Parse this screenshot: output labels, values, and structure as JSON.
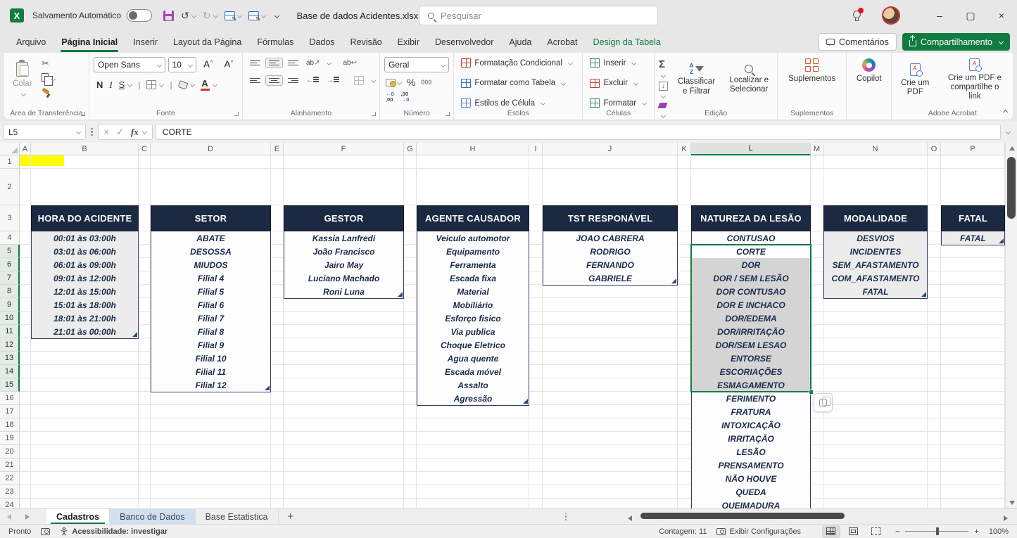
{
  "colors": {
    "accent_green": "#107C41",
    "table_header_navy": "#1b2942",
    "selection_fill": "#d4d4d4",
    "highlight_yellow": "#ffff00"
  },
  "icons": {
    "search": "magnifier",
    "save": "floppy-disk",
    "undo": "arrow-ccw",
    "redo": "arrow-cw",
    "comments": "speech-bubble",
    "share": "box-arrow-up",
    "copilot": "color-swirl",
    "addins": "orange-grid",
    "pdf": "page-with-link"
  },
  "titlebar": {
    "autosave_label": "Salvamento Automático",
    "filename": "Base de dados Acidentes.xlsx",
    "search_placeholder": "Pesquisar",
    "undo_glyph": "↺",
    "redo_glyph": "↻",
    "minimize": "–",
    "maximize": "▢",
    "close": "×"
  },
  "ribbon_tabs": [
    {
      "label": "Arquivo"
    },
    {
      "label": "Página Inicial",
      "active": true
    },
    {
      "label": "Inserir"
    },
    {
      "label": "Layout da Página"
    },
    {
      "label": "Fórmulas"
    },
    {
      "label": "Dados"
    },
    {
      "label": "Revisão"
    },
    {
      "label": "Exibir"
    },
    {
      "label": "Desenvolvedor"
    },
    {
      "label": "Ajuda"
    },
    {
      "label": "Acrobat"
    },
    {
      "label": "Design da Tabela",
      "contextual": true
    }
  ],
  "tabrow_right": {
    "comments": "Comentários",
    "share": "Compartilhamento"
  },
  "ribbon": {
    "clipboard": {
      "paste": "Colar",
      "group": "Área de Transferência"
    },
    "font": {
      "family": "Open Sans",
      "size": "10",
      "bold": "N",
      "italic": "I",
      "underline": "S",
      "group": "Fonte"
    },
    "alignment": {
      "group": "Alinhamento",
      "orient": "ab",
      "wrap": "ab"
    },
    "number": {
      "format": "Geral",
      "percent": "%",
      "thousands": "000",
      "inc_dec": "←0",
      "inc_dec2": ",00",
      "dec_dec": ",00",
      "dec_dec2": "→0",
      "group": "Número"
    },
    "styles": {
      "conditional": "Formatação Condicional",
      "format_table": "Formatar como Tabela",
      "cell_styles": "Estilos de Célula",
      "group": "Estilos"
    },
    "cells": {
      "insert": "Inserir",
      "delete": "Excluir",
      "format": "Formatar",
      "group": "Células"
    },
    "editing": {
      "sort": "Classificar e Filtrar",
      "find": "Localizar e Selecionar",
      "group": "Edição"
    },
    "addins": {
      "button": "Suplementos",
      "group": "Suplementos"
    },
    "copilot": {
      "button": "Copilot"
    },
    "acrobat": {
      "create_pdf": "Crie um PDF",
      "create_share": "Crie um PDF e compartilhe o link",
      "group": "Adobe Acrobat"
    }
  },
  "formula_bar": {
    "name_box": "L5",
    "value": "CORTE",
    "fx": "fx",
    "cancel": "×",
    "enter": "✓"
  },
  "grid": {
    "columns": [
      "A",
      "B",
      "C",
      "D",
      "E",
      "F",
      "G",
      "H",
      "I",
      "J",
      "K",
      "L",
      "M",
      "N",
      "O",
      "P"
    ],
    "row_count": 24,
    "selected_column": "L",
    "selected_rows_from": 5,
    "selected_rows_to": 15,
    "active_cell": "L5",
    "tables": [
      {
        "title": "HORA DO ACIDENTE",
        "column": "B",
        "shaded": true,
        "handle": true,
        "values": [
          "00:01 às 03:00h",
          "03:01 às 06:00h",
          "06:01 às 09:00h",
          "09:01 às 12:00h",
          "12:01 às 15:00h",
          "15:01 às 18:00h",
          "18:01 às 21:00h",
          "21:01 às 00:00h"
        ]
      },
      {
        "title": "SETOR",
        "column": "D",
        "shaded": false,
        "handle": true,
        "values": [
          "ABATE",
          "DESOSSA",
          "MIUDOS",
          "Filial 4",
          "Filial 5",
          "Filial 6",
          "Filial 7",
          "Filial 8",
          "Filial 9",
          "Filial 10",
          "Filial 11",
          "Filial 12"
        ]
      },
      {
        "title": "GESTOR",
        "column": "F",
        "shaded": false,
        "handle": true,
        "values": [
          "Kassia Lanfredi",
          "João Francisco",
          "Jairo May",
          "Luciano Machado",
          "Roni Luna"
        ]
      },
      {
        "title": "AGENTE CAUSADOR",
        "column": "H",
        "shaded": false,
        "handle": true,
        "values": [
          "Veiculo automotor",
          "Equipamento",
          "Ferramenta",
          "Escada fixa",
          "Material",
          "Mobiliário",
          "Esforço fisico",
          "Via publica",
          "Choque Eletrico",
          "Agua quente",
          "Escada móvel",
          "Assalto",
          "Agressão"
        ]
      },
      {
        "title": "TST RESPONÁVEL",
        "column": "J",
        "shaded": false,
        "handle": true,
        "values": [
          "JOAO CABRERA",
          "RODRIGO",
          "FERNANDO",
          "GABRIELE"
        ]
      },
      {
        "title": "NATUREZA DA LESÃO",
        "column": "L",
        "shaded": false,
        "handle": false,
        "selected": true,
        "values": [
          "CONTUSAO",
          "CORTE",
          "DOR",
          "DOR / SEM LESÃO",
          "DOR CONTUSAO",
          "DOR E INCHACO",
          "DOR/EDEMA",
          "DOR/IRRITAÇÃO",
          "DOR/SEM LESAO",
          "ENTORSE",
          "ESCORIAÇÕES",
          "ESMAGAMENTO",
          "FERIMENTO",
          "FRATURA",
          "INTOXICAÇÃO",
          "IRRITAÇÃO",
          "LESÃO",
          "PRENSAMENTO",
          "NÃO HOUVE",
          "QUEDA",
          "QUEIMADURA"
        ]
      },
      {
        "title": "MODALIDADE",
        "column": "N",
        "shaded": true,
        "handle": true,
        "values": [
          "DESVIOS",
          "INCIDENTES",
          "SEM_AFASTAMENTO",
          "COM_AFASTAMENTO",
          "FATAL"
        ]
      },
      {
        "title": "FATAL",
        "column": "P",
        "shaded": true,
        "handle": true,
        "yellow_above": true,
        "values": [
          "FATAL"
        ]
      }
    ]
  },
  "sheet_tabs": [
    {
      "label": "Cadastros",
      "active": true
    },
    {
      "label": "Banco de Dados",
      "highlight": true
    },
    {
      "label": "Base Estatistica"
    }
  ],
  "new_sheet": "+",
  "status_bar": {
    "ready": "Pronto",
    "accessibility": "Acessibilidade: investigar",
    "count": "Contagem: 11",
    "settings": "Exibir Configurações",
    "zoom_level": "100%",
    "zoom_minus": "−",
    "zoom_plus": "+"
  }
}
